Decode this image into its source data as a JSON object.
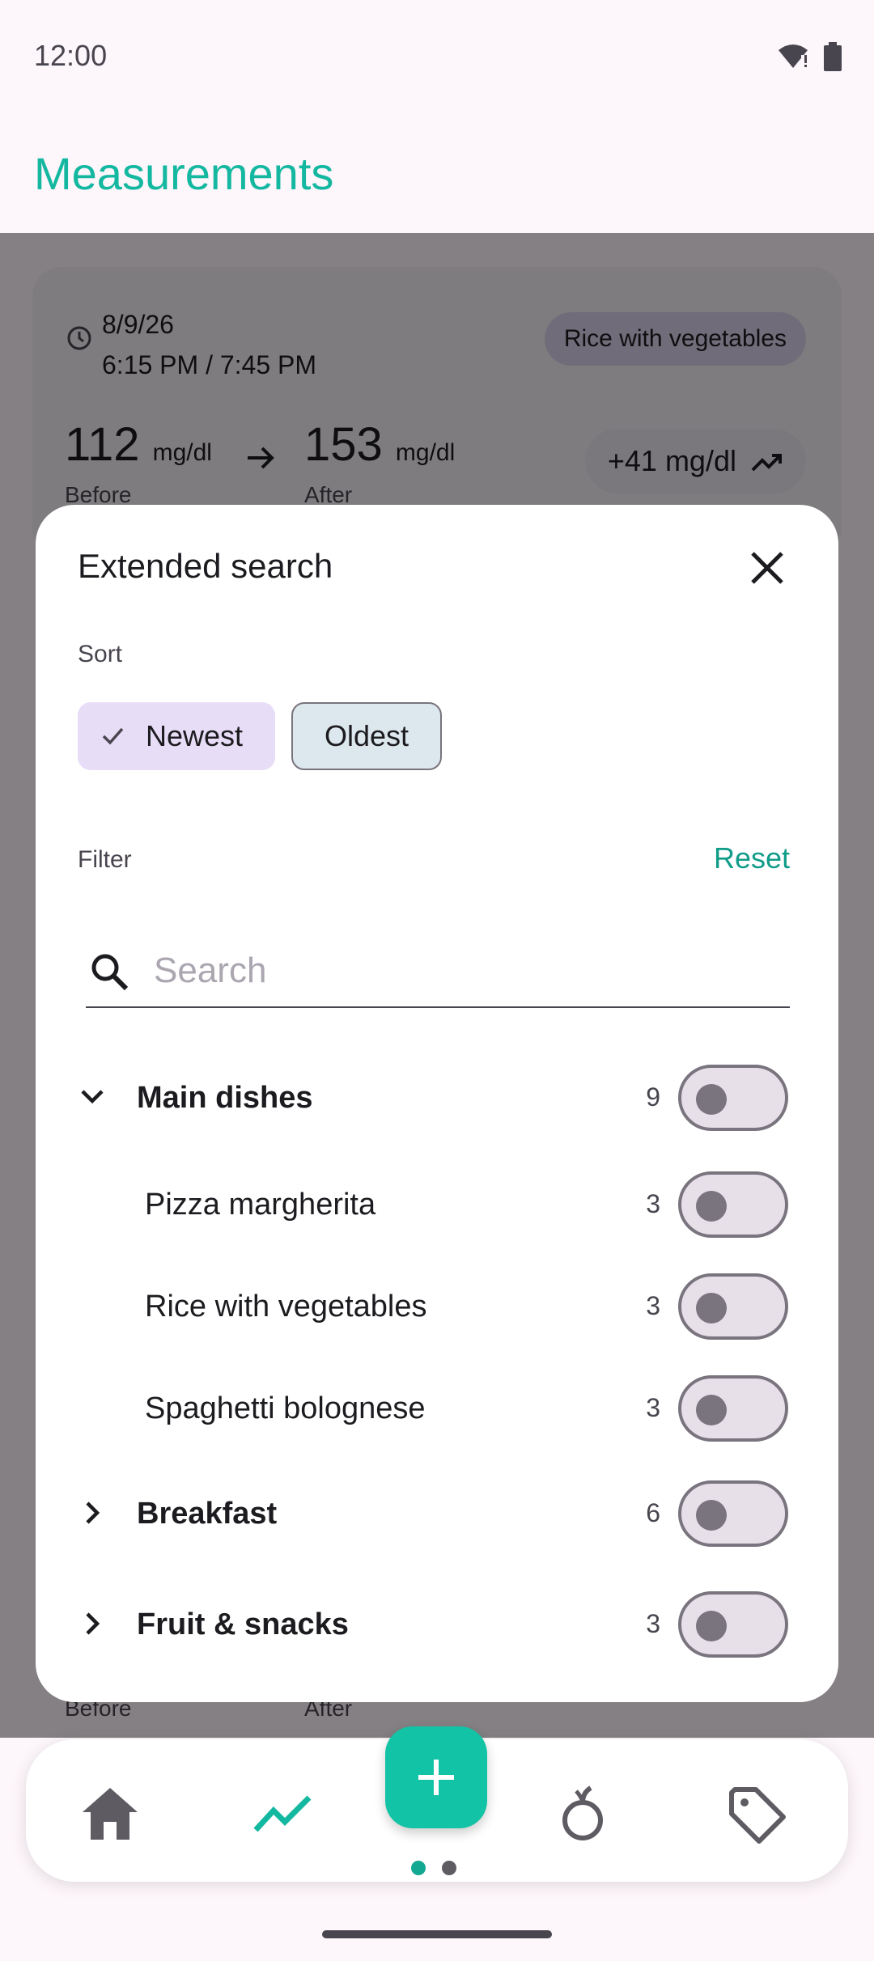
{
  "status_bar": {
    "time": "12:00"
  },
  "app_bar": {
    "title": "Measurements"
  },
  "background_card": {
    "date": "8/9/26",
    "time_range": "6:15 PM / 7:45 PM",
    "tag": "Rice with vegetables",
    "before_value": "112",
    "after_value": "153",
    "unit": "mg/dl",
    "before_label": "Before",
    "after_label": "After",
    "delta": "+41 mg/dl"
  },
  "dialog": {
    "title": "Extended search",
    "sort_label": "Sort",
    "sort_options": [
      {
        "label": "Newest",
        "selected": true
      },
      {
        "label": "Oldest",
        "selected": false
      }
    ],
    "filter_label": "Filter",
    "reset_label": "Reset",
    "search_placeholder": "Search",
    "rows": [
      {
        "name": "Main dishes",
        "count": "9",
        "group": true,
        "expanded": true
      },
      {
        "name": "Pizza margherita",
        "count": "3",
        "group": false
      },
      {
        "name": "Rice with vegetables",
        "count": "3",
        "group": false
      },
      {
        "name": "Spaghetti bolognese",
        "count": "3",
        "group": false
      },
      {
        "name": "Breakfast",
        "count": "6",
        "group": true,
        "expanded": false
      },
      {
        "name": "Fruit & snacks",
        "count": "3",
        "group": true,
        "expanded": false
      }
    ]
  },
  "bottom_nav": {
    "items": [
      "home-icon",
      "trending-up-icon",
      "add-icon",
      "fruit-icon",
      "tag-icon"
    ],
    "active_index": 1,
    "page_dots": 2,
    "active_dot": 0
  },
  "colors": {
    "accent": "#14b8a0",
    "fab": "#13c3a6",
    "chip_selected": "#e8ddf7"
  }
}
